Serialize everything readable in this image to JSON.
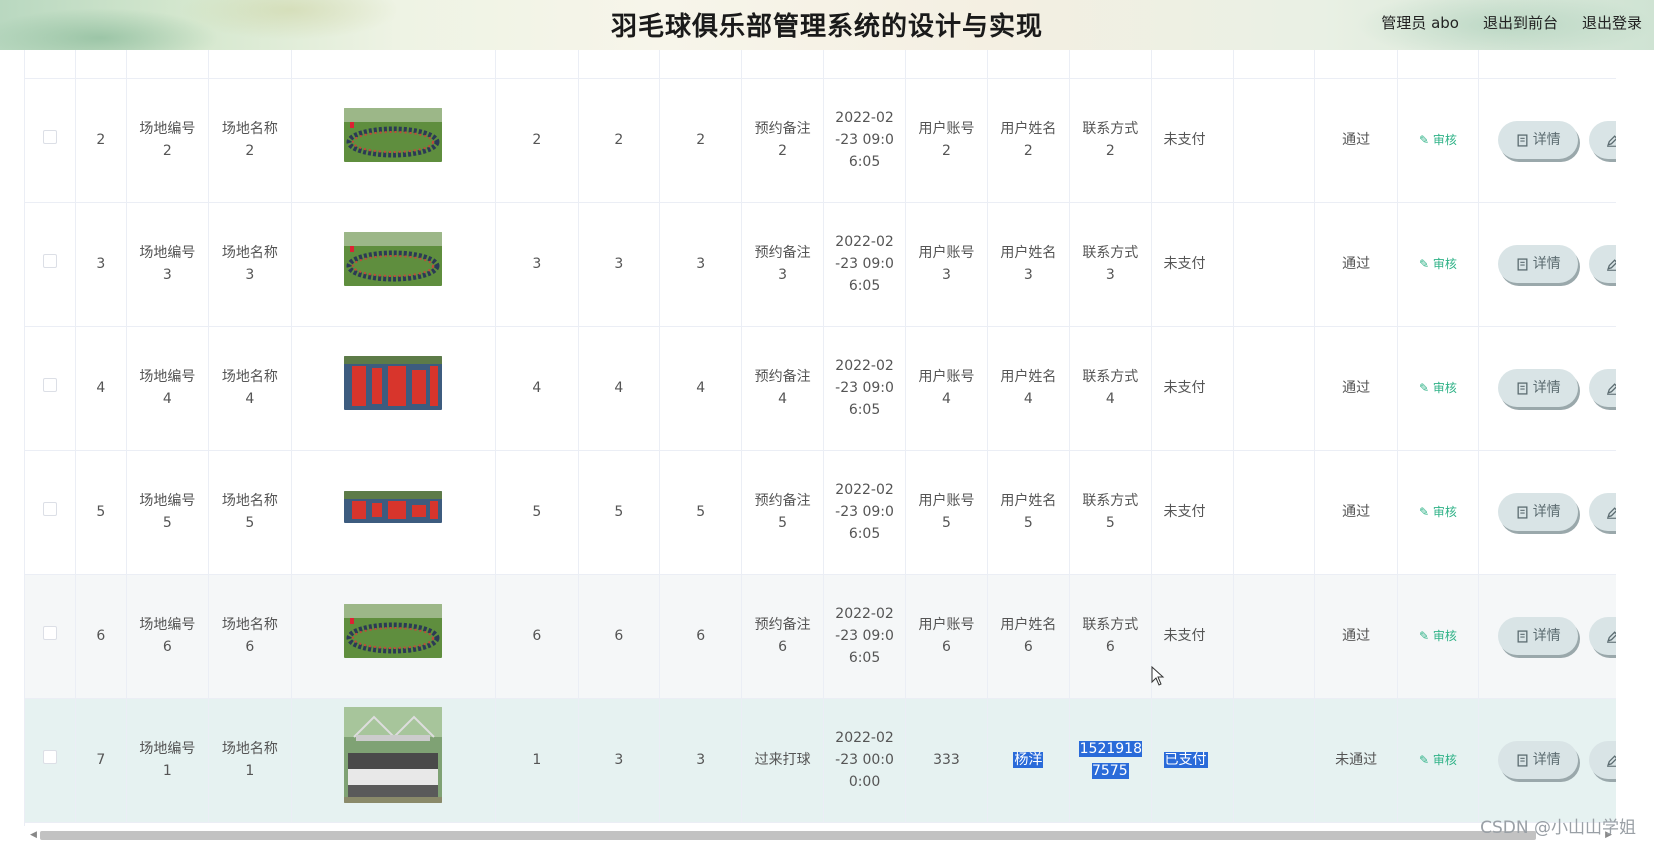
{
  "header": {
    "title": "羽毛球俱乐部管理系统的设计与实现",
    "user_label": "管理员 abo",
    "front_link": "退出到前台",
    "logout_link": "退出登录"
  },
  "actions": {
    "audit": "审核",
    "detail": "详情",
    "edit": "修改"
  },
  "rows": [
    {
      "index": "2",
      "venue_no": "场地编号\n2",
      "venue_name": "场地名称\n2",
      "c1": "2",
      "c2": "2",
      "c3": "2",
      "note": "预约备注\n2",
      "time": "2022-02\n-23 09:0\n6:05",
      "account": "用户账号\n2",
      "name": "用户姓名\n2",
      "phone": "联系方式\n2",
      "pay": "未支付",
      "status": "通过"
    },
    {
      "index": "3",
      "venue_no": "场地编号\n3",
      "venue_name": "场地名称\n3",
      "c1": "3",
      "c2": "3",
      "c3": "3",
      "note": "预约备注\n3",
      "time": "2022-02\n-23 09:0\n6:05",
      "account": "用户账号\n3",
      "name": "用户姓名\n3",
      "phone": "联系方式\n3",
      "pay": "未支付",
      "status": "通过"
    },
    {
      "index": "4",
      "venue_no": "场地编号\n4",
      "venue_name": "场地名称\n4",
      "c1": "4",
      "c2": "4",
      "c3": "4",
      "note": "预约备注\n4",
      "time": "2022-02\n-23 09:0\n6:05",
      "account": "用户账号\n4",
      "name": "用户姓名\n4",
      "phone": "联系方式\n4",
      "pay": "未支付",
      "status": "通过"
    },
    {
      "index": "5",
      "venue_no": "场地编号\n5",
      "venue_name": "场地名称\n5",
      "c1": "5",
      "c2": "5",
      "c3": "5",
      "note": "预约备注\n5",
      "time": "2022-02\n-23 09:0\n6:05",
      "account": "用户账号\n5",
      "name": "用户姓名\n5",
      "phone": "联系方式\n5",
      "pay": "未支付",
      "status": "通过"
    },
    {
      "index": "6",
      "venue_no": "场地编号\n6",
      "venue_name": "场地名称\n6",
      "c1": "6",
      "c2": "6",
      "c3": "6",
      "note": "预约备注\n6",
      "time": "2022-02\n-23 09:0\n6:05",
      "account": "用户账号\n6",
      "name": "用户姓名\n6",
      "phone": "联系方式\n6",
      "pay": "未支付",
      "status": "通过"
    },
    {
      "index": "7",
      "venue_no": "场地编号\n1",
      "venue_name": "场地名称\n1",
      "c1": "1",
      "c2": "3",
      "c3": "3",
      "note": "过来打球",
      "time": "2022-02\n-23 00:0\n0:00",
      "account": "333",
      "name": "杨洋",
      "phone": "1521918\n7575",
      "pay": "已支付",
      "status": "未通过"
    }
  ],
  "watermark": "CSDN @小山山学姐",
  "colors": {
    "accent": "#2fb287",
    "selection": "#2a6bd9",
    "button_bg": "#d9e4e6",
    "hover_row": "#f5f7f8",
    "current_row": "#e6f2f1"
  }
}
